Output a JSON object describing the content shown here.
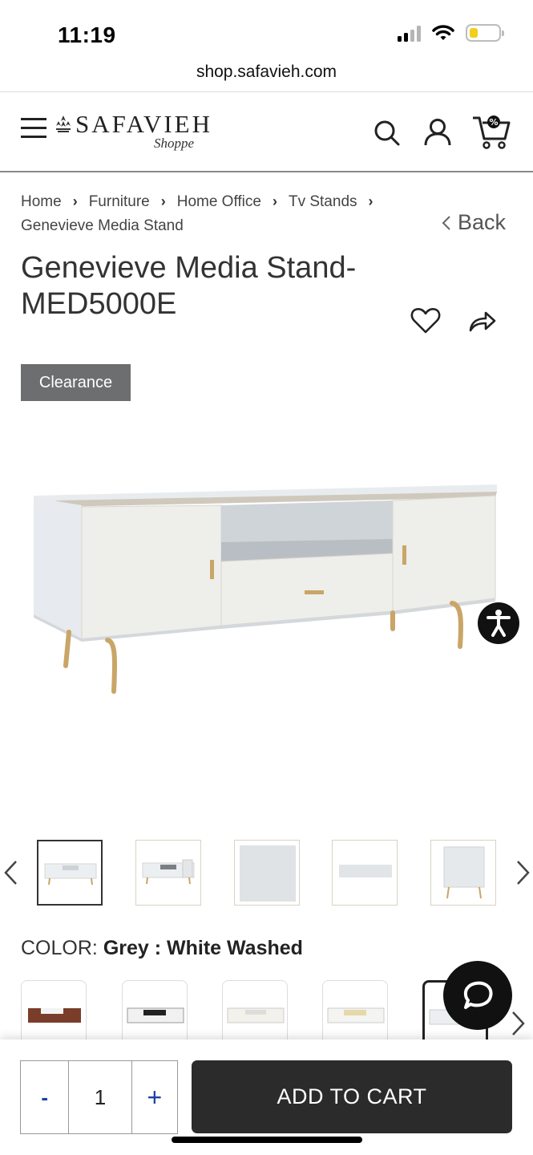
{
  "status_bar": {
    "time": "11:19"
  },
  "browser": {
    "url": "shop.safavieh.com"
  },
  "header": {
    "logo_text": "SAFAVIEH",
    "logo_sub": "Shoppe"
  },
  "breadcrumb": {
    "items": [
      "Home",
      "Furniture",
      "Home Office",
      "Tv Stands",
      "Genevieve Media Stand"
    ]
  },
  "back_label": "Back",
  "product": {
    "title": "Genevieve Media Stand-MED5000E",
    "badge": "Clearance",
    "color_label": "COLOR:",
    "color_value": "Grey : White Washed"
  },
  "cart": {
    "minus_label": "-",
    "quantity": "1",
    "plus_label": "+",
    "add_to_cart_label": "ADD TO CART"
  },
  "icons": {
    "menu": "hamburger-menu-icon",
    "search": "search-icon",
    "account": "user-icon",
    "cart": "cart-icon",
    "wishlist": "heart-icon",
    "share": "share-icon",
    "accessibility": "accessibility-icon",
    "chat": "chat-icon"
  },
  "colors": {
    "badge_bg": "#6d6e70",
    "button_bg": "#2b2b2b",
    "qty_accent": "#1f3fa8",
    "battery": "#f2cf1d"
  }
}
